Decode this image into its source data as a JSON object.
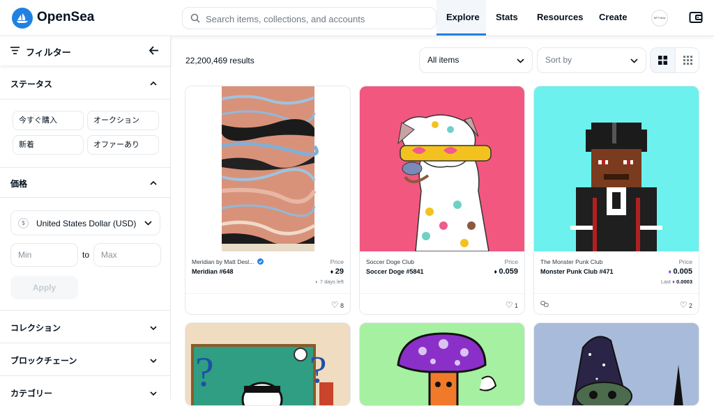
{
  "header": {
    "brand": "OpenSea",
    "search_placeholder": "Search items, collections, and accounts",
    "nav": [
      "Explore",
      "Stats",
      "Resources",
      "Create"
    ],
    "avatar_text": "NFT Now",
    "accent_color": "#2081e2"
  },
  "sidebar": {
    "filter_label": "フィルター",
    "status": {
      "title": "ステータス",
      "options": [
        "今すぐ購入",
        "オークション",
        "新着",
        "オファーあり"
      ]
    },
    "price": {
      "title": "価格",
      "currency_symbol": "$",
      "currency": "United States Dollar (USD)",
      "min_placeholder": "Min",
      "to_label": "to",
      "max_placeholder": "Max",
      "apply_label": "Apply"
    },
    "sections": [
      "コレクション",
      "ブロックチェーン",
      "カテゴリー"
    ]
  },
  "main": {
    "results": "22,200,469 results",
    "items_filter": "All items",
    "sort_placeholder": "Sort by",
    "cards": [
      {
        "collection": "Meridian by Matt Desl...",
        "name": "Meridian #648",
        "price_label": "Price",
        "price": "29",
        "sub": "7 days left",
        "likes": "8",
        "verified": true
      },
      {
        "collection": "Soccer Doge Club",
        "name": "Soccer Doge #5841",
        "price_label": "Price",
        "price": "0.059",
        "sub": "",
        "likes": "1",
        "verified": false
      },
      {
        "collection": "The Monster Punk Club",
        "name": "Monster Punk Club #471",
        "price_label": "Price",
        "price": "0.005",
        "sub_label": "Last",
        "sub": "0.0003",
        "likes": "2",
        "verified": false
      }
    ]
  }
}
